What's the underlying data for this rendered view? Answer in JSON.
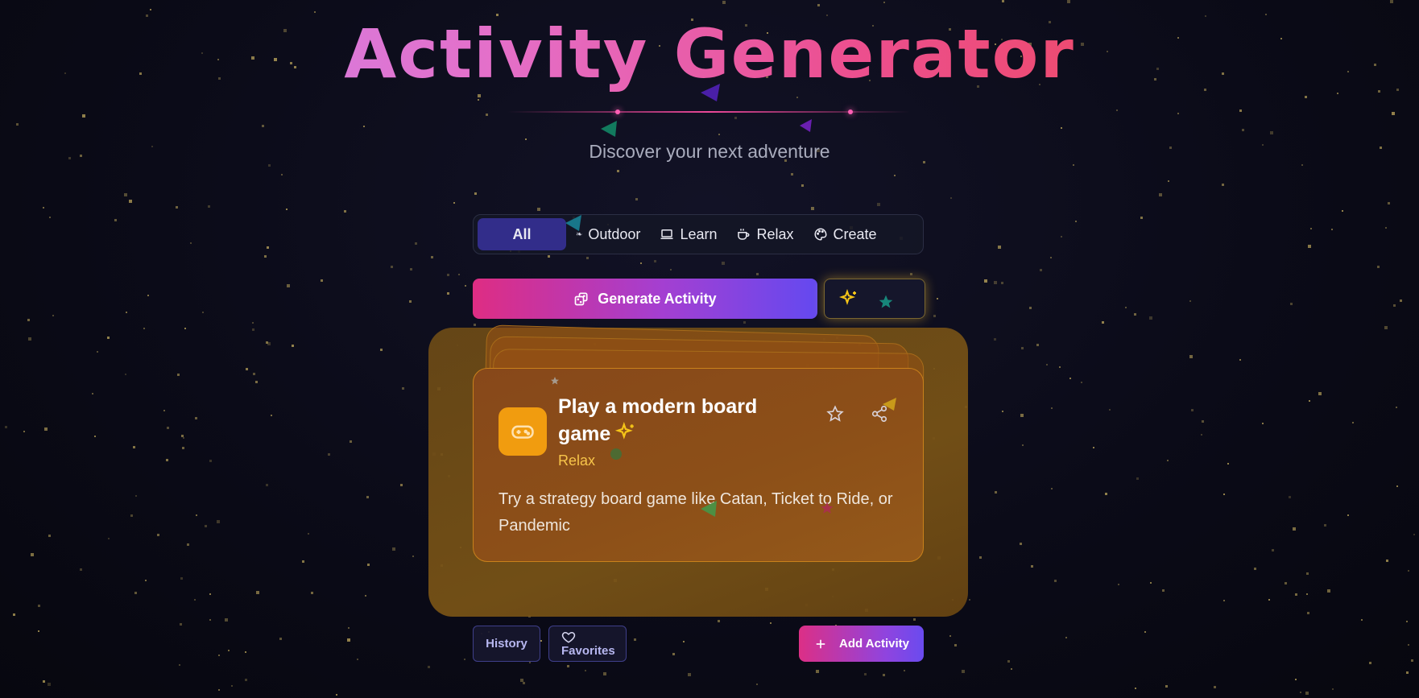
{
  "header": {
    "title": "Activity Generator",
    "subtitle": "Discover your next adventure"
  },
  "filters": [
    {
      "label": "All",
      "icon": "none",
      "active": true
    },
    {
      "label": "Outdoor",
      "icon": "leaf-icon",
      "active": false
    },
    {
      "label": "Learn",
      "icon": "laptop-icon",
      "active": false
    },
    {
      "label": "Relax",
      "icon": "coffee-icon",
      "active": false
    },
    {
      "label": "Create",
      "icon": "palette-icon",
      "active": false
    }
  ],
  "generate": {
    "label": "Generate Activity",
    "icon": "dice-icon",
    "sparkle_icon": "sparkles-icon"
  },
  "activity": {
    "title": "Play a modern board game",
    "category": "Relax",
    "description": "Try a strategy board game like Catan, Ticket to Ride, or Pandemic",
    "icon": "gamepad-icon",
    "actions": [
      "star-icon",
      "share-icon"
    ]
  },
  "footer": {
    "history_label": "History",
    "favorites_label": "Favorites",
    "favorites_icon": "heart-icon",
    "add_label": "Add Activity",
    "add_icon": "plus-icon"
  },
  "colors": {
    "background": "#0b0b18",
    "accent_pink": "#de2d83",
    "accent_violet": "#6449f0",
    "active_tab": "#322d8a",
    "card_orange": "#8c4f18",
    "icon_tile": "#f19c0f",
    "category_text": "#f7c54a"
  }
}
